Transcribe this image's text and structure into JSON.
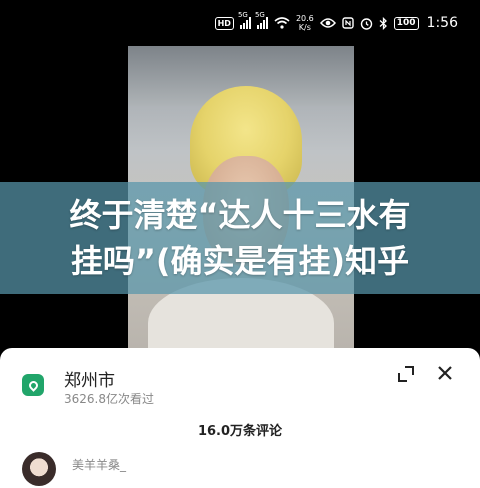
{
  "status_bar": {
    "hd_label": "HD",
    "signal1_label": "5G",
    "signal2_label": "5G",
    "net_speed_value": "20.6",
    "net_speed_unit": "K/s",
    "battery": "100",
    "time": "1:56"
  },
  "video": {
    "overlay_line1": "终于清楚“达人十三水有",
    "overlay_line2": "挂吗”(确实是有挂)知乎"
  },
  "sheet": {
    "location_title": "郑州市",
    "views": "3626.8亿次看过",
    "comment_count": "16.0万条评论",
    "first_comment": {
      "username": "美羊羊桑_"
    }
  },
  "colors": {
    "location_icon": "#21a56a",
    "overlay": "#5896aa"
  },
  "icons": [
    "hd-icon",
    "signal-icon",
    "wifi-icon",
    "eye-icon",
    "nfc-icon",
    "alarm-icon",
    "bluetooth-icon",
    "battery-icon",
    "location-icon",
    "expand-icon",
    "close-icon"
  ]
}
